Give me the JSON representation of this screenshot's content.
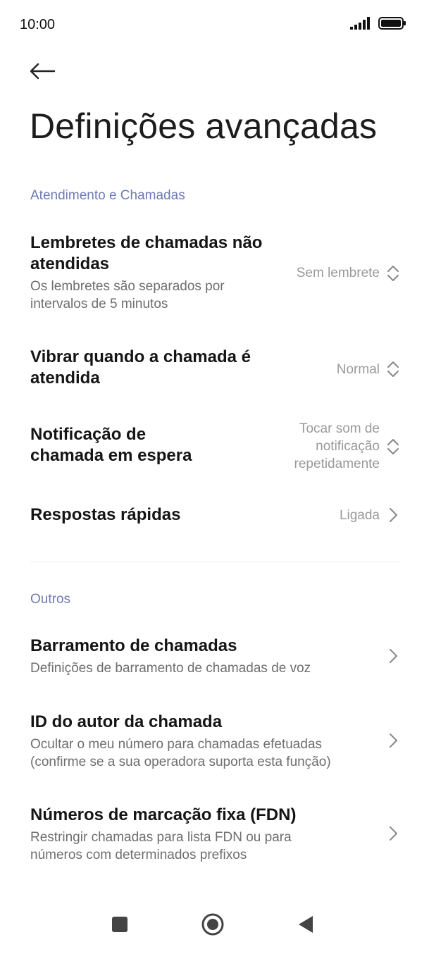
{
  "status": {
    "time": "10:00"
  },
  "title": "Definições avançadas",
  "sections": [
    {
      "header": "Atendimento e Chamadas",
      "items": [
        {
          "main": "Lembretes de chamadas não\natendidas",
          "sub": "Os lembretes são separados por\nintervalos de 5 minutos",
          "value": "Sem lembrete",
          "icon": "updown-chevron-icon"
        },
        {
          "main": "Vibrar quando a chamada é\natendida",
          "value": "Normal",
          "icon": "updown-chevron-icon"
        },
        {
          "main": "Notificação de\nchamada em espera",
          "value": "Tocar som de\nnotificação\nrepetidamente",
          "icon": "updown-chevron-icon"
        },
        {
          "main": "Respostas rápidas",
          "value": "Ligada",
          "icon": "chevron-right-icon"
        }
      ]
    },
    {
      "header": "Outros",
      "items": [
        {
          "main": "Barramento de chamadas",
          "sub": "Definições de barramento de chamadas de voz",
          "icon": "chevron-right-icon"
        },
        {
          "main": "ID do autor da chamada",
          "sub": "Ocultar o meu número para chamadas efetuadas\n(confirme se a sua operadora suporta esta função)",
          "icon": "chevron-right-icon"
        },
        {
          "main": "Números de marcação fixa (FDN)",
          "sub": "Restringir chamadas para lista FDN ou para\nnúmeros com determinados prefixos",
          "icon": "chevron-right-icon"
        }
      ]
    }
  ],
  "colors": {
    "section_header": "#6e7bb3",
    "value": "#9a9a9a"
  }
}
